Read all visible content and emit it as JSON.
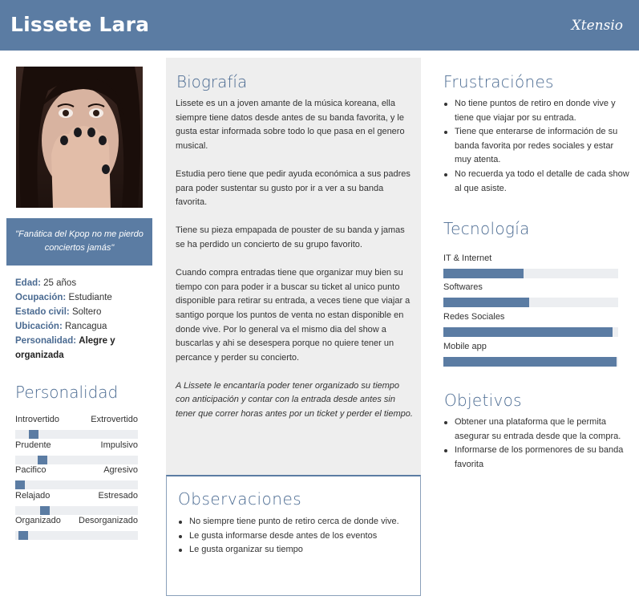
{
  "header": {
    "name": "Lissete Lara",
    "brand": "Xtensio",
    "color": "#5b7ca3"
  },
  "photo": {
    "icon": "portrait-photo"
  },
  "quote": "\"Fanática del Kpop no me pierdo conciertos jamás\"",
  "info": {
    "edad_label": "Edad:",
    "edad": "25 años",
    "ocupacion_label": "Ocupación:",
    "ocupacion": "Estudiante",
    "estado_label": "Estado civil:",
    "estado": "Soltero",
    "ubicacion_label": "Ubicación:",
    "ubicacion": "Rancagua",
    "personalidad_label": "Personalidad:",
    "personalidad": "Alegre y organizada"
  },
  "personalidad": {
    "title": "Personalidad",
    "traits": [
      {
        "left": "Introvertido",
        "right": "Extrovertido",
        "value": 0.12
      },
      {
        "left": "Prudente",
        "right": "Impulsivo",
        "value": 0.2
      },
      {
        "left": "Pacifico",
        "right": "Agresivo",
        "value": 0.0
      },
      {
        "left": "Relajado",
        "right": "Estresado",
        "value": 0.22
      },
      {
        "left": "Organizado",
        "right": "Desorganizado",
        "value": 0.03
      }
    ]
  },
  "biografia": {
    "title": "Biografía",
    "p1": "Lissete es un a joven amante de la música koreana, ella siempre tiene datos desde antes de su banda favorita, y le gusta estar informada sobre todo lo que pasa en el genero musical.",
    "p2": "Estudia pero tiene que pedir ayuda económica a sus padres para poder sustentar su gusto por ir a ver a su banda favorita.",
    "p3": "Tiene su pieza empapada de pouster de su banda y jamas se ha perdido un concierto de su grupo favorito.",
    "p4": "Cuando compra entradas tiene que organizar muy bien su tiempo con para poder ir a buscar su ticket al unico punto disponible para retirar su entrada, a veces tiene que viajar a santigo porque los puntos de venta no estan disponible en donde vive. Por lo general va el mismo dia del show a buscarlas y ahi se desespera porque no quiere tener un percance y perder su concierto.",
    "p5": "A Lissete le encantaría poder tener organizado su tiempo con anticipación y contar con la entrada desde antes sin tener que correr horas antes por un ticket y perder el tiempo."
  },
  "observaciones": {
    "title": "Observaciones",
    "items": [
      "No siempre tiene punto de retiro cerca de donde vive.",
      "Le gusta informarse desde antes de los eventos",
      "Le gusta organizar su tiempo"
    ]
  },
  "frustraciones": {
    "title": "Frustraciónes",
    "items": [
      "No tiene puntos de retiro en donde vive y tiene que viajar por su entrada.",
      "Tiene que enterarse de información de su banda favorita por redes sociales y estar muy atenta.",
      "No recuerda ya todo el detalle de cada show al que asiste."
    ]
  },
  "tecnologia": {
    "title": "Tecnología",
    "items": [
      {
        "label": "IT & Internet",
        "value": 0.46
      },
      {
        "label": "Softwares",
        "value": 0.49
      },
      {
        "label": "Redes Sociales",
        "value": 0.97
      },
      {
        "label": "Mobile app",
        "value": 0.99
      }
    ]
  },
  "objetivos": {
    "title": "Objetivos",
    "items": [
      "Obtener una plataforma que le permita asegurar su entrada desde que la compra.",
      "Informarse de los pormenores de su banda favorita"
    ]
  }
}
